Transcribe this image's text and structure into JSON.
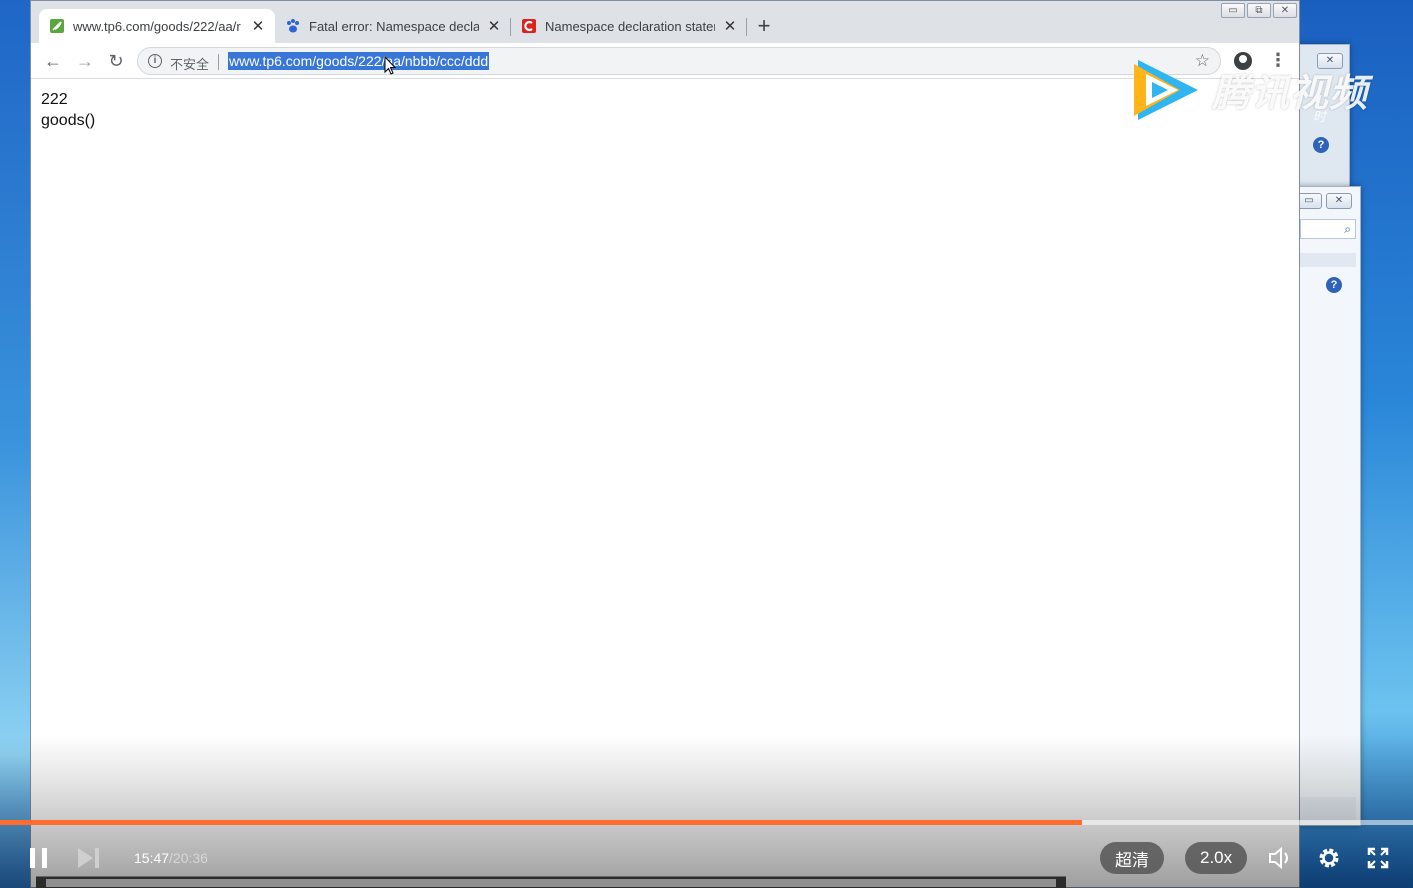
{
  "browser": {
    "tabs": [
      {
        "title": "www.tp6.com/goods/222/aa/r",
        "active": true
      },
      {
        "title": "Fatal error: Namespace declar",
        "active": false
      },
      {
        "title": "Namespace declaration staten",
        "active": false
      }
    ],
    "new_tab_symbol": "+",
    "address": {
      "security_label": "不安全",
      "url": "www.tp6.com/goods/222/aa/nbbb/ccc/ddd"
    },
    "page_lines": [
      "222",
      "goods()"
    ]
  },
  "watermark": {
    "brand": "腾讯视频",
    "slogan": "不负好时光"
  },
  "player": {
    "current_time": "15:47",
    "total_time": "/20:36",
    "progress_fraction": 0.766,
    "quality_label": "超清",
    "speed_label": "2.0x"
  },
  "colors": {
    "progress": "#ff6c2d",
    "url_highlight": "#3876d8"
  }
}
